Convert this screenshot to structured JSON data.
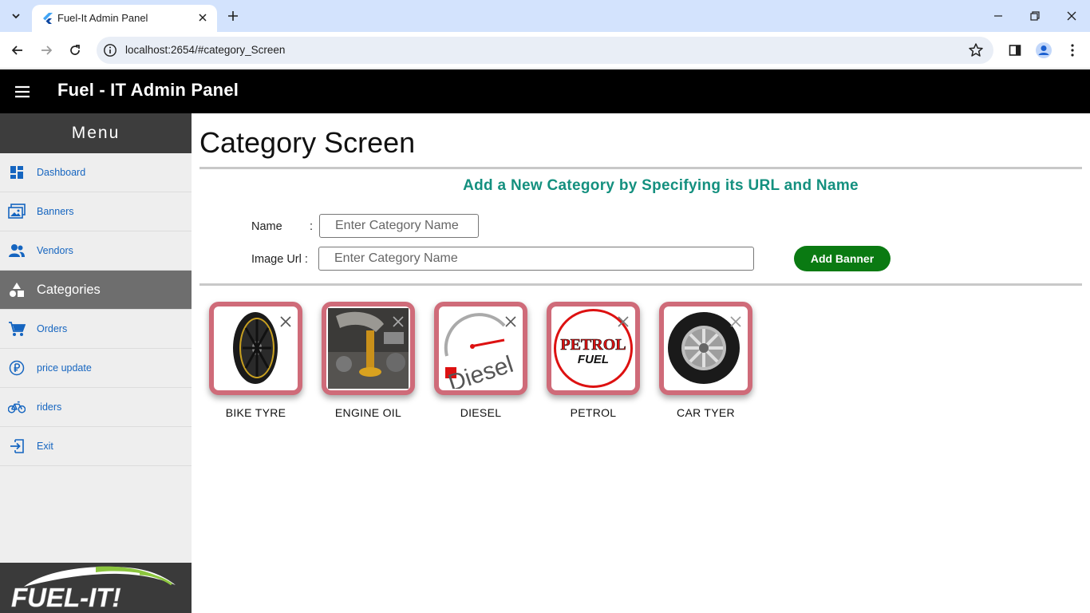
{
  "browser": {
    "tab_title": "Fuel-It Admin Panel",
    "url": "localhost:2654/#category_Screen"
  },
  "app": {
    "title": "Fuel - IT Admin Panel"
  },
  "sidebar": {
    "header": "Menu",
    "items": [
      {
        "label": "Dashboard",
        "icon": "dashboard-icon"
      },
      {
        "label": "Banners",
        "icon": "image-icon"
      },
      {
        "label": "Vendors",
        "icon": "people-icon"
      },
      {
        "label": "Categories",
        "icon": "category-icon",
        "active": true
      },
      {
        "label": "Orders",
        "icon": "cart-icon"
      },
      {
        "label": "price update",
        "icon": "currency-icon"
      },
      {
        "label": "riders",
        "icon": "bike-icon"
      },
      {
        "label": "Exit",
        "icon": "exit-icon"
      }
    ],
    "logo_text": "FUEL-IT!"
  },
  "main": {
    "title": "Category Screen",
    "subtitle": "Add a New Category by Specifying its URL and Name",
    "name_label": "Name",
    "name_colon": ":",
    "name_placeholder": "Enter Category Name",
    "url_label": "Image Url :",
    "url_placeholder": "Enter Category Name",
    "add_button": "Add Banner"
  },
  "categories": [
    {
      "name": "BIKE TYRE"
    },
    {
      "name": "ENGINE OIL"
    },
    {
      "name": "DIESEL",
      "image_text": "Diesel"
    },
    {
      "name": "PETROL",
      "image_text_top": "PETROL",
      "image_text_bottom": "FUEL"
    },
    {
      "name": "CAR TYER"
    }
  ],
  "colors": {
    "accent_teal": "#14907f",
    "button_green": "#0a7a12",
    "card_border": "#cf6b79",
    "sidebar_link": "#1565c0"
  }
}
